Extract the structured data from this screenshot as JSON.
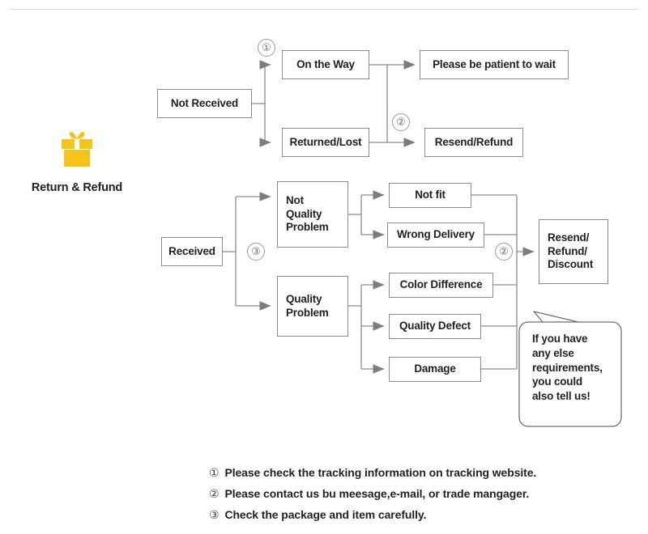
{
  "badge": {
    "icon": "gift-box-icon",
    "icon_color": "#F7C318",
    "caption": "Return & Refund"
  },
  "theme": {
    "box_border": "#8b8b8b",
    "wire": "#8b8b8b",
    "text": "#231f20",
    "marker": "#9a9a9a",
    "rule": "#dcdcdc"
  },
  "flow": {
    "not_received": "Not Received",
    "on_the_way": "On the Way",
    "returned_lost": "Returned/Lost",
    "please_wait": "Please be patient to wait",
    "resend_refund": "Resend/Refund",
    "received": "Received",
    "not_quality_problem": "Not\nQuality\nProblem",
    "quality_problem": "Quality\nProblem",
    "not_fit": "Not fit",
    "wrong_delivery": "Wrong Delivery",
    "color_difference": "Color Difference",
    "quality_defect": "Quality Defect",
    "damage": "Damage",
    "resend_refund_discount": "Resend/\nRefund/\nDiscount"
  },
  "markers": {
    "m1": "①",
    "m2_top": "②",
    "m3": "③",
    "m2_bottom": "②"
  },
  "bubble": {
    "text": "If you have\nany else\nrequirements,\nyou could\nalso tell us!"
  },
  "notes": [
    {
      "num": "①",
      "text": "Please check the tracking information on tracking website."
    },
    {
      "num": "②",
      "text": "Please contact us bu meesage,e-mail, or trade mangager."
    },
    {
      "num": "③",
      "text": "Check the package and item carefully."
    }
  ]
}
